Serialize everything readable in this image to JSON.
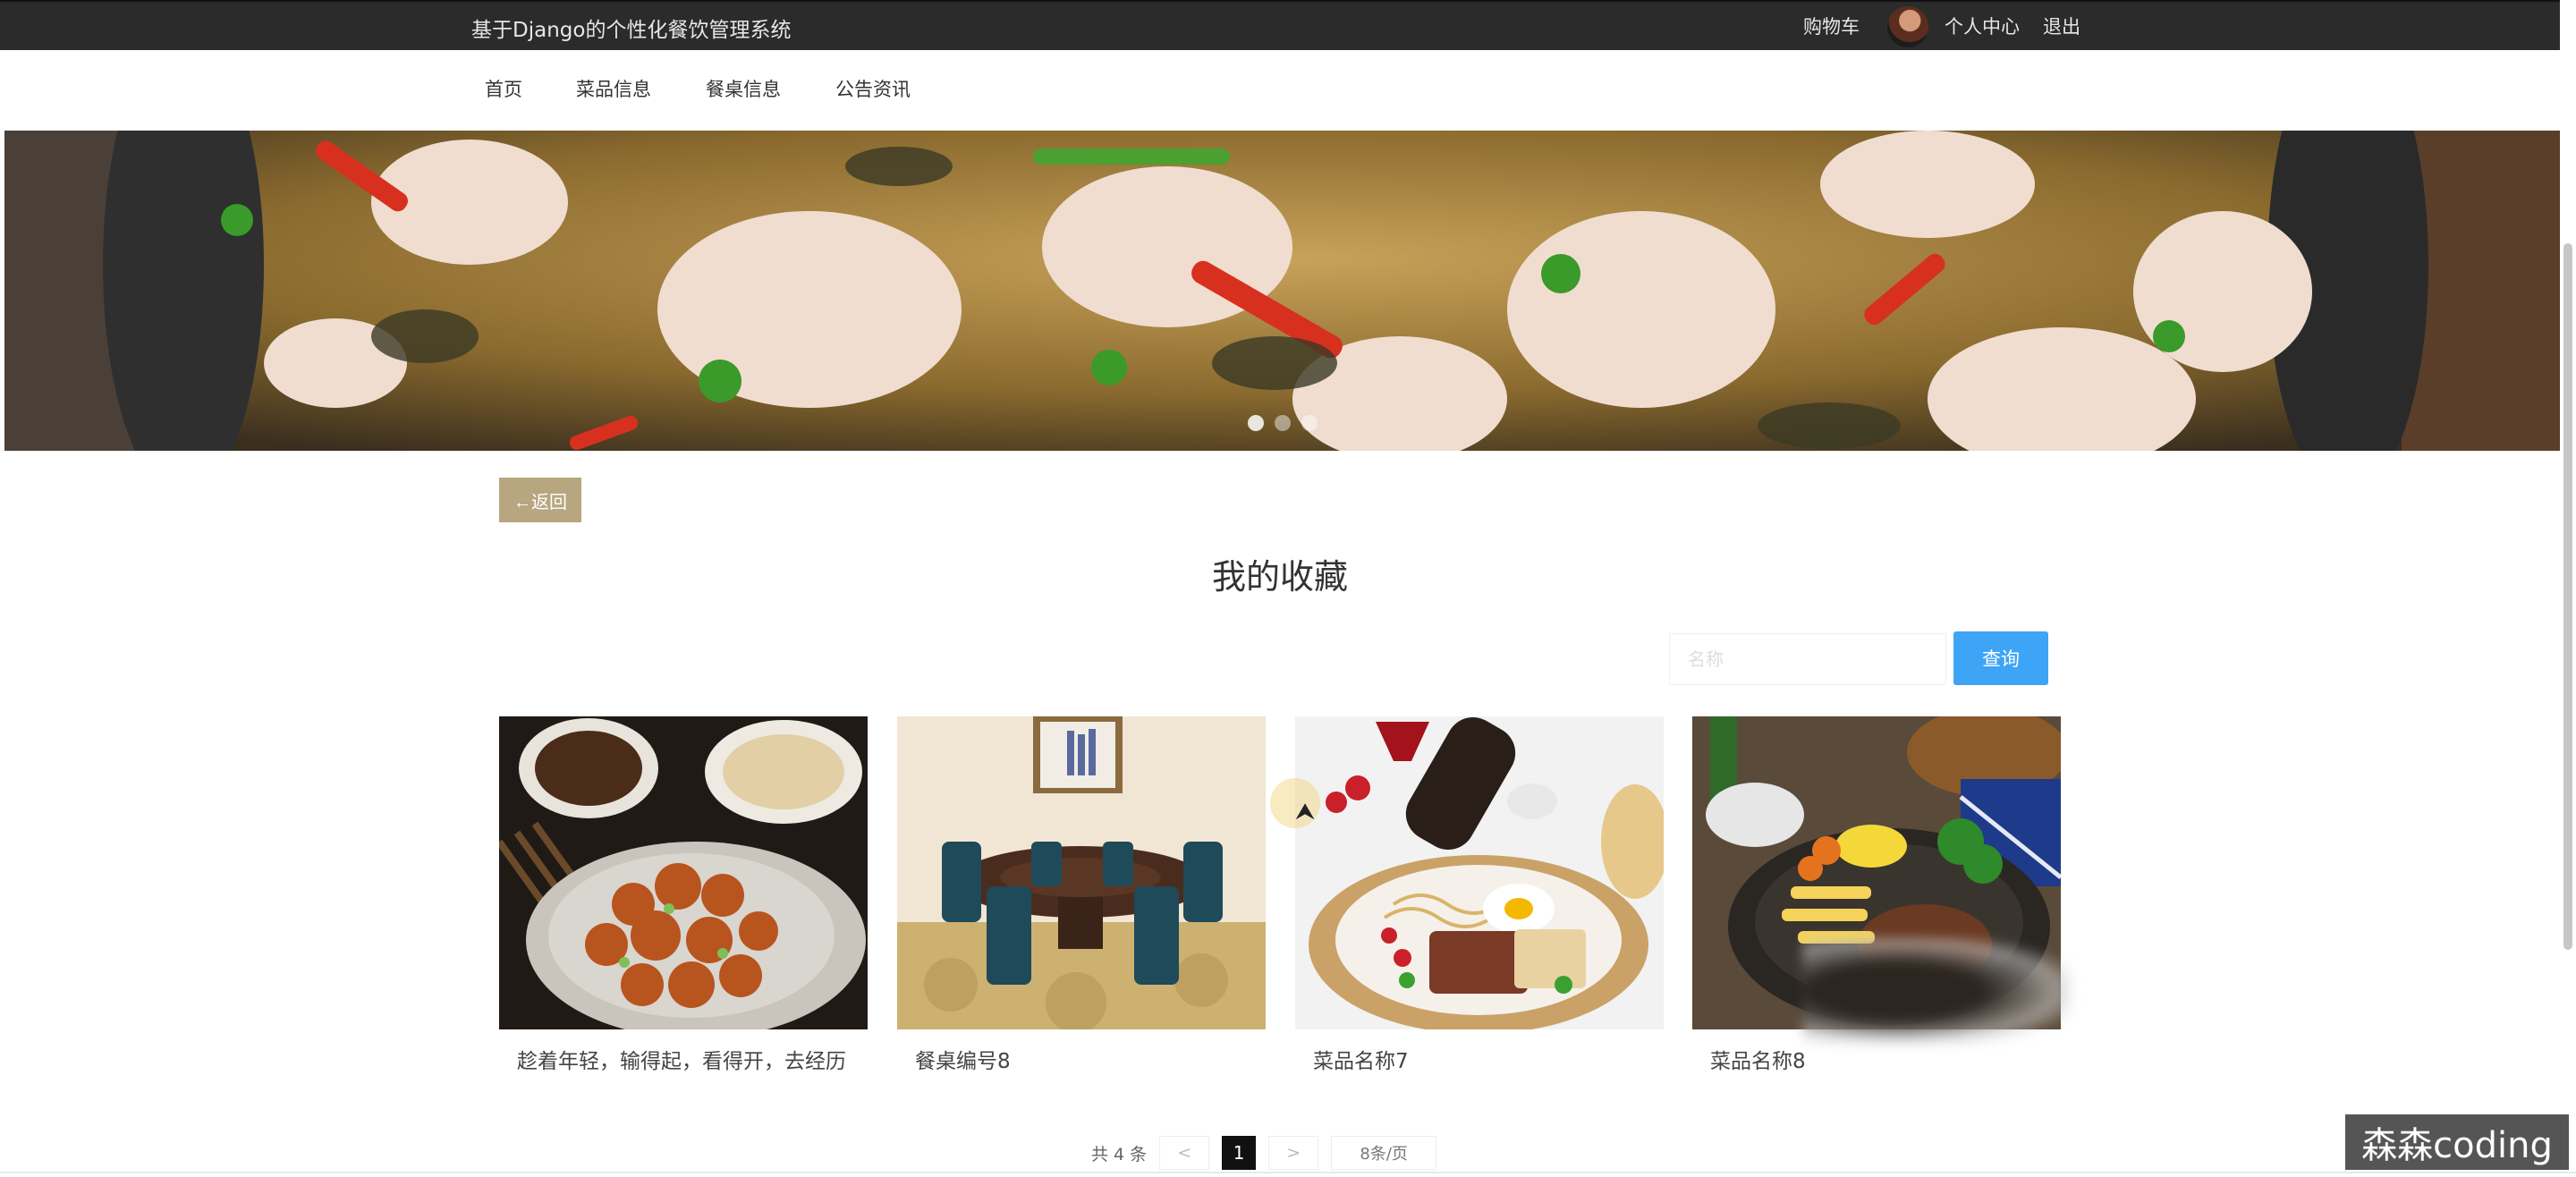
{
  "header": {
    "site_title": "基于Django的个性化餐饮管理系统",
    "cart_label": "购物车",
    "profile_label": "个人中心",
    "logout_label": "退出"
  },
  "nav": {
    "items": [
      {
        "label": "首页"
      },
      {
        "label": "菜品信息"
      },
      {
        "label": "餐桌信息"
      },
      {
        "label": "公告资讯"
      }
    ]
  },
  "banner": {
    "dots_count": 3,
    "active_index": 0
  },
  "back_button": {
    "label": "←返回"
  },
  "page_title": "我的收藏",
  "search": {
    "placeholder": "名称",
    "button_label": "查询"
  },
  "favorites": [
    {
      "name": "趁着年轻，输得起，看得开，去经历",
      "image": "fried-chicken-dish"
    },
    {
      "name": "餐桌编号8",
      "image": "dining-table-room"
    },
    {
      "name": "菜品名称7",
      "image": "steak-plate"
    },
    {
      "name": "菜品名称8",
      "image": "sizzling-steak"
    }
  ],
  "pagination": {
    "total_text": "共 4 条",
    "prev_label": "<",
    "current_page": "1",
    "next_label": ">",
    "page_size_label": "8条/页"
  },
  "watermark": "森森coding",
  "colors": {
    "topbar": "#2b2b2b",
    "accent_gold": "#b7a67f",
    "search_blue": "#3ea4f6"
  }
}
